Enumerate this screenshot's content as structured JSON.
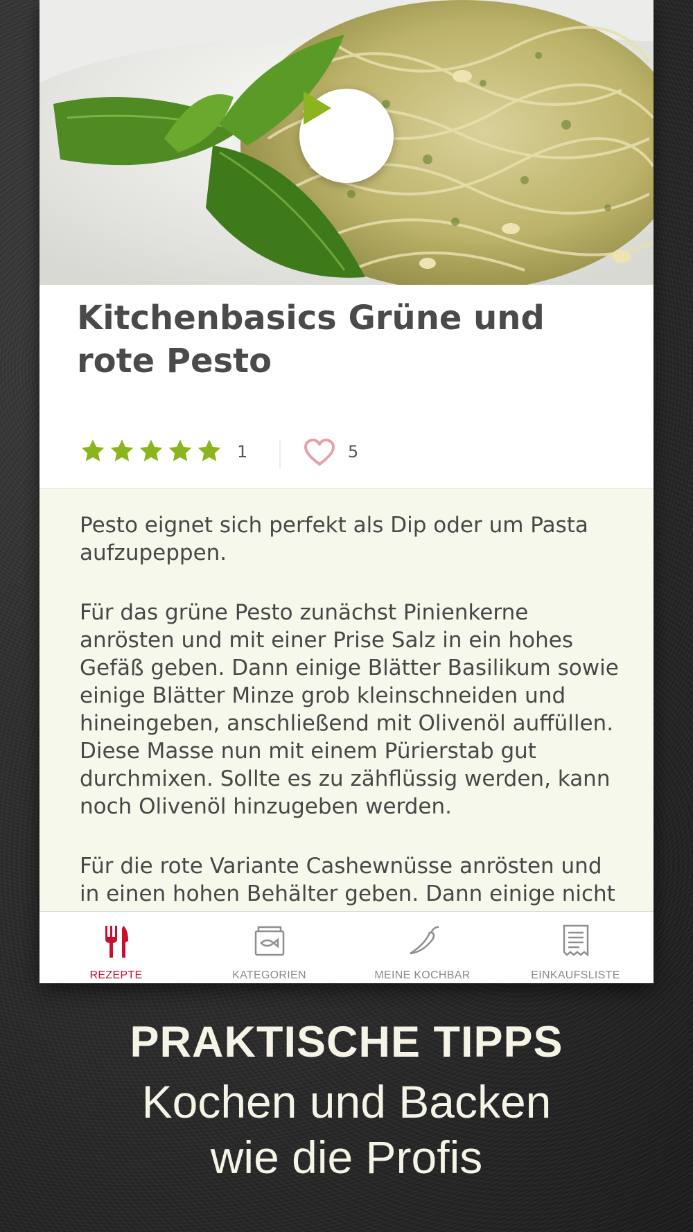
{
  "recipe": {
    "title_line1": "Kitchenbasics Grüne und",
    "title_line2": "rote Pesto",
    "rating": 5,
    "rating_count": "1",
    "like_count": "5",
    "paragraphs": [
      "Pesto eignet sich perfekt als Dip oder um Pasta aufzupeppen.",
      "Für das grüne Pesto zunächst Pinienkerne anrösten und mit einer Prise Salz in ein hohes Gefäß geben. Dann einige Blätter Basilikum sowie einige Blätter Minze grob kleinschneiden und hineingeben, anschließend mit Olivenöl auffüllen. Diese Masse nun mit einem Pürierstab gut durchmixen. Sollte es zu zähflüssig werden, kann noch Olivenöl hinzugeben werden.",
      "Für die rote Variante Cashewnüsse anrösten und in einen hohen Behälter geben. Dann einige nicht in"
    ]
  },
  "tabs": [
    {
      "label": "REZEPTE",
      "icon": "fork-knife-icon",
      "active": true
    },
    {
      "label": "KATEGORIEN",
      "icon": "category-box-icon",
      "active": false
    },
    {
      "label": "MEINE KOCHBAR",
      "icon": "chili-icon",
      "active": false
    },
    {
      "label": "EINKAUFSLISTE",
      "icon": "receipt-list-icon",
      "active": false
    }
  ],
  "promo": {
    "headline": "PRAKTISCHE TIPPS",
    "line1": "Kochen und Backen",
    "line2": "wie die Profis"
  },
  "colors": {
    "accent_green": "#8cb41e",
    "active_red": "#c8102e",
    "heart_pink": "#e8a0a8",
    "description_bg": "#f7f8ec"
  }
}
